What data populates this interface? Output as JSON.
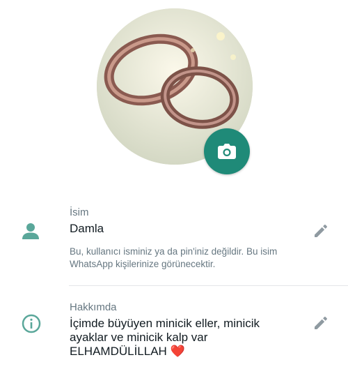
{
  "profile": {
    "photo": {
      "alt_icon": "ring-photo"
    },
    "camera_button": {
      "icon": "camera-icon",
      "color": "#1f8a78"
    }
  },
  "name_section": {
    "icon": "person-icon",
    "label": "İsim",
    "value": "Damla",
    "note": "Bu, kullanıcı isminiz ya da pin'iniz değildir. Bu isim WhatsApp kişilerinize görünecektir.",
    "edit_icon": "pencil-icon"
  },
  "about_section": {
    "icon": "info-icon",
    "label": "Hakkımda",
    "value": "İçimde büyüyen minicik eller, minicik ayaklar ve minicik kalp var ELHAMDÜLİLLAH ❤️",
    "edit_icon": "pencil-icon"
  },
  "colors": {
    "accent": "#1f8a78",
    "icon_teal": "#5aa79a",
    "muted": "#667781"
  }
}
